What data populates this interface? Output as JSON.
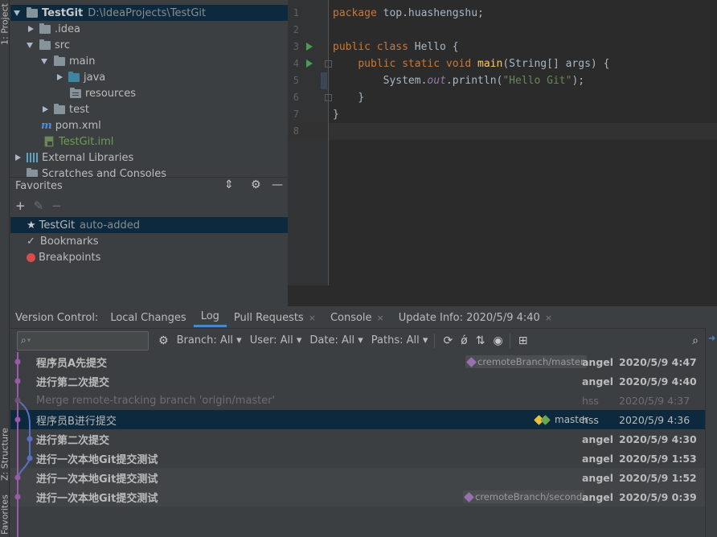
{
  "stripe": {
    "project_tab": "1: Project",
    "structure_tab": "Z: Structure",
    "favorites_tab": "Favorites"
  },
  "project_tree": {
    "items": [
      {
        "label": "TestGit",
        "path": "D:\\IdeaProjects\\TestGit",
        "icon": "folder-icon",
        "expanded": true,
        "selected": true
      },
      {
        "label": ".idea",
        "icon": "folder-icon",
        "expanded": false
      },
      {
        "label": "src",
        "icon": "folder-icon",
        "expanded": true
      },
      {
        "label": "main",
        "icon": "folder-icon",
        "expanded": true
      },
      {
        "label": "java",
        "icon": "source-folder-icon",
        "expanded": false
      },
      {
        "label": "resources",
        "icon": "resources-folder-icon"
      },
      {
        "label": "test",
        "icon": "folder-icon",
        "expanded": false
      },
      {
        "label": "pom.xml",
        "icon": "maven-icon"
      },
      {
        "label": "TestGit.iml",
        "icon": "iml-file-icon"
      },
      {
        "label": "External Libraries",
        "icon": "libraries-icon",
        "expanded": false
      },
      {
        "label": "Scratches and Consoles",
        "icon": "scratches-icon"
      }
    ]
  },
  "favorites": {
    "title": "Favorites",
    "items": [
      {
        "label": "TestGit",
        "suffix": "auto-added",
        "icon": "star-icon"
      },
      {
        "label": "Bookmarks",
        "icon": "check-icon"
      },
      {
        "label": "Breakpoints",
        "icon": "breakpoint-icon"
      }
    ]
  },
  "editor": {
    "line_numbers": [
      "1",
      "2",
      "3",
      "4",
      "5",
      "6",
      "7",
      "8"
    ],
    "lines": {
      "l1_kw": "package",
      "l1_rest": " top.huashengshu;",
      "l3_kw": "public class",
      "l3_rest": " Hello {",
      "l4_kw": "public static void",
      "l4_fn": "main",
      "l4_rest": "(String[] args) {",
      "l5_a": "System.",
      "l5_fld": "out",
      "l5_b": ".println(",
      "l5_str": "\"Hello Git\"",
      "l5_c": ");",
      "l6": "}",
      "l7": "}"
    }
  },
  "vc": {
    "label": "Version Control:",
    "tabs": [
      {
        "label": "Local Changes",
        "closable": false
      },
      {
        "label": "Log",
        "closable": false,
        "active": true
      },
      {
        "label": "Pull Requests",
        "closable": true
      },
      {
        "label": "Console",
        "closable": true
      },
      {
        "label": "Update Info: 2020/5/9 4:40",
        "closable": true
      }
    ],
    "close_glyph": "×"
  },
  "log_toolbar": {
    "search_placeholder": "",
    "filters": {
      "branch": "Branch: All",
      "user": "User: All",
      "date": "Date: All",
      "paths": "Paths: All"
    }
  },
  "commits": [
    {
      "message": "程序员A先提交",
      "ref": "cremoteBranch/master",
      "author": "angel",
      "date": "2020/5/9 4:47"
    },
    {
      "message": "进行第二次提交",
      "ref": "",
      "author": "angel",
      "date": "2020/5/9 4:40"
    },
    {
      "message": "Merge remote-tracking branch 'origin/master'",
      "ref": "",
      "author": "hss",
      "date": "2020/5/9 4:37"
    },
    {
      "message": "程序员B进行提交",
      "ref": "master",
      "author": "hss",
      "date": "2020/5/9 4:36"
    },
    {
      "message": "进行第二次提交",
      "ref": "",
      "author": "angel",
      "date": "2020/5/9 4:30"
    },
    {
      "message": "进行一次本地Git提交测试",
      "ref": "",
      "author": "angel",
      "date": "2020/5/9 1:53"
    },
    {
      "message": "进行一次本地Git提交测试",
      "ref": "",
      "author": "angel",
      "date": "2020/5/9 1:52"
    },
    {
      "message": "进行一次本地Git提交测试",
      "ref": "cremoteBranch/second",
      "author": "angel",
      "date": "2020/5/9 0:39"
    }
  ],
  "colors": {
    "graph_purple": "#9a5aa8",
    "graph_blue": "#5a6fc0",
    "tag_yellow": "#e8c13b",
    "tag_green": "#6aa84f",
    "remote_tag": "#9a6fb0",
    "selection": "#0d293e"
  }
}
